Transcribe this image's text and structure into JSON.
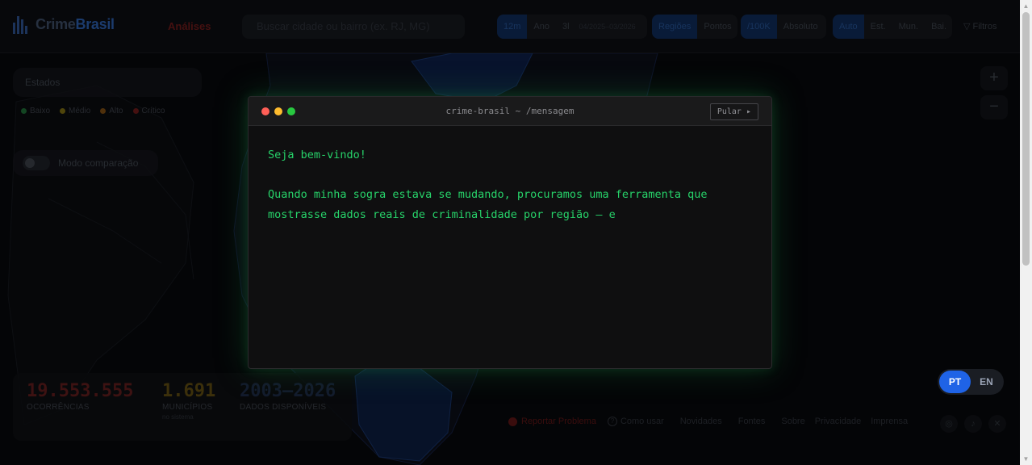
{
  "app": {
    "brand_part1": "Crime",
    "brand_part2": "Brasil"
  },
  "nav": {
    "analises": "Análises",
    "search_placeholder": "Buscar cidade ou bairro (ex. RJ, MG)"
  },
  "period": {
    "options": [
      "12m",
      "Ano",
      "3l"
    ],
    "active": "12m",
    "date_range": "04/2025–03/2026"
  },
  "view": {
    "options": [
      "Regiões",
      "Pontos"
    ],
    "active": "Regiões"
  },
  "metric": {
    "options": [
      "/100K",
      "Absoluto"
    ],
    "active": "/100K"
  },
  "level": {
    "options": [
      "Auto",
      "Est.",
      "Mun.",
      "Bai."
    ],
    "active": "Auto"
  },
  "filters_label": "Filtros",
  "states_panel": {
    "title": "Estados"
  },
  "legend": [
    {
      "label": "Baixo",
      "color": "#1e6b35"
    },
    {
      "label": "Médio",
      "color": "#7a6a12"
    },
    {
      "label": "Alto",
      "color": "#7a4a12"
    },
    {
      "label": "Crítico",
      "color": "#6b1a1a"
    }
  ],
  "compare_label": "Modo comparação",
  "zoom": {
    "in": "+",
    "out": "−"
  },
  "stats": [
    {
      "value": "19.553.555",
      "label": "OCORRÊNCIAS",
      "sub": "",
      "color": "#5e1c1c"
    },
    {
      "value": "1.691",
      "label": "MUNICÍPIOS",
      "sub": "no sistema",
      "color": "#5c4a12"
    },
    {
      "value": "2003–2026",
      "label": "DADOS DISPONÍVEIS",
      "sub": "",
      "color": "#1e2a45"
    }
  ],
  "footer": {
    "report": "Reportar Problema",
    "how": "Como usar",
    "links": [
      "Novidades",
      "Fontes",
      "Sobre",
      "Privacidade",
      "Imprensa"
    ]
  },
  "language": {
    "options": [
      "PT",
      "EN"
    ],
    "active": "PT"
  },
  "modal": {
    "title": "crime-brasil ~ /mensagem",
    "skip": "Pular ▸",
    "line1": "Seja bem-vindo!",
    "line2": "Quando minha sogra estava se mudando, procuramos uma ferramenta que mostrasse dados reais de criminalidade por região — e"
  }
}
